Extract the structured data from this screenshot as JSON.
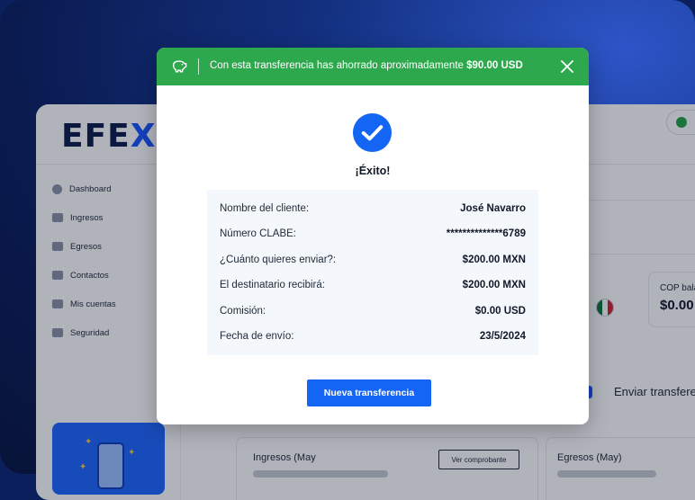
{
  "app": {
    "logo_main": "EFE",
    "logo_accent": "X",
    "sidebar": {
      "items": [
        {
          "label": "Dashboard"
        },
        {
          "label": "Ingresos"
        },
        {
          "label": "Egresos"
        },
        {
          "label": "Contactos"
        },
        {
          "label": "Mis cuentas"
        },
        {
          "label": "Seguridad"
        }
      ]
    },
    "cards": {
      "cop_label": "COP bala",
      "cop_value": "$0.00",
      "send_label": "Enviar transfere",
      "ingresos_label": "Ingresos (May",
      "ver_comprobante": "Ver comprobante",
      "egresos_label": "Egresos (May)"
    }
  },
  "modal": {
    "banner": {
      "message_prefix": "Con esta transferencia has ahorrado aproximadamente",
      "message_amount": "$90.00 USD",
      "color": "#2ea84d"
    },
    "success_title": "¡Éxito!",
    "details": [
      {
        "label": "Nombre del cliente:",
        "value": "José Navarro"
      },
      {
        "label": "Número CLABE:",
        "value": "**************6789"
      },
      {
        "label": "¿Cuánto quieres enviar?:",
        "value": "$200.00 MXN"
      },
      {
        "label": "El destinatario recibirá:",
        "value": "$200.00 MXN"
      },
      {
        "label": "Comisión:",
        "value": "$0.00 USD"
      },
      {
        "label": "Fecha de envío:",
        "value": "23/5/2024"
      }
    ],
    "primary_button": "Nueva transferencia",
    "accent_color": "#1565f5"
  }
}
